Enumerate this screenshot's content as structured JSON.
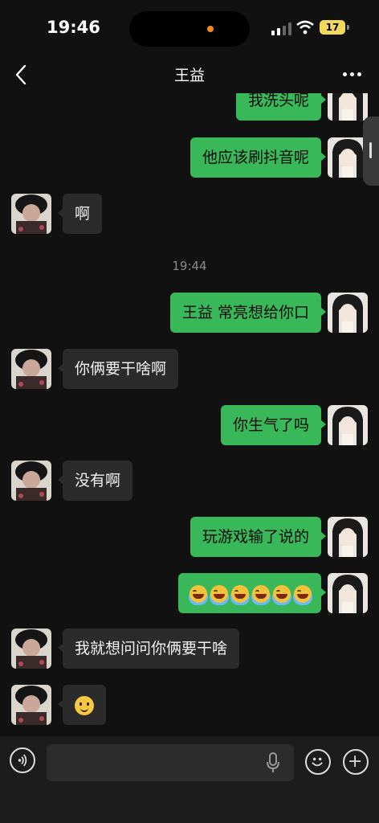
{
  "status_bar": {
    "time": "19:46",
    "battery": "17"
  },
  "header": {
    "title": "王益"
  },
  "messages": [
    {
      "side": "me",
      "text": "我洗头呢"
    },
    {
      "side": "me",
      "text": "他应该刷抖音呢"
    },
    {
      "side": "other",
      "text": "啊"
    },
    {
      "timestamp": "19:44"
    },
    {
      "side": "me",
      "text": "王益 常亮想给你口"
    },
    {
      "side": "other",
      "text": "你俩要干啥啊"
    },
    {
      "side": "me",
      "text": "你生气了吗"
    },
    {
      "side": "other",
      "text": "没有啊"
    },
    {
      "side": "me",
      "text": "玩游戏输了说的"
    },
    {
      "side": "me",
      "emoji": "tears-of-joy",
      "count": 6
    },
    {
      "side": "other",
      "text": "我就想问问你俩要干啥"
    },
    {
      "side": "other",
      "emoji": "smiley"
    }
  ],
  "input": {
    "value": "",
    "placeholder": ""
  },
  "icons": {
    "back": "chevron-left-icon",
    "more": "more-dots-icon",
    "voice": "voice-icon",
    "mic": "mic-icon",
    "emoji": "emoji-icon",
    "plus": "plus-icon"
  },
  "colors": {
    "my_bubble": "#39b85a",
    "their_bubble": "#2b2b2b",
    "background": "#111111"
  }
}
